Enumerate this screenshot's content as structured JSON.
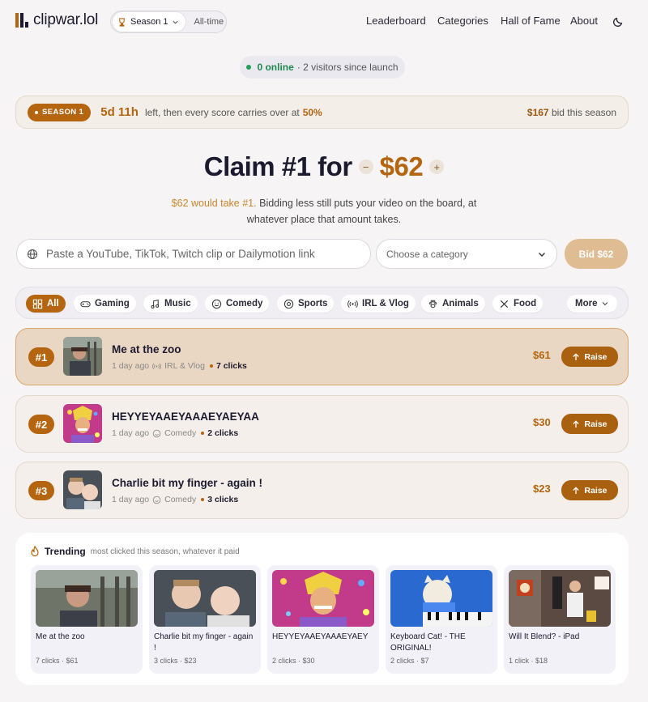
{
  "brand": {
    "name": "clipwar.lol"
  },
  "season_selector": {
    "label": "Season 1",
    "alt": "All-time"
  },
  "nav": [
    "Leaderboard",
    "Categories",
    "Hall of Fame",
    "About"
  ],
  "online": {
    "count": "0 online",
    "rest": "· 2 visitors since launch"
  },
  "season_banner": {
    "badge": "SEASON 1",
    "time_left": "5d 11h",
    "text": "left, then every score carries over at",
    "carry_pct": "50%",
    "bid_amount": "$167",
    "bid_text": "bid this season"
  },
  "claim": {
    "heading": "Claim #1 for",
    "amount": "$62",
    "minus": "−",
    "plus": "+",
    "sub_highlight": "$62 would take #1.",
    "sub_rest": "Bidding less still puts your video on the board, at whatever place that amount takes."
  },
  "form": {
    "url_placeholder": "Paste a YouTube, TikTok, Twitch clip or Dailymotion link",
    "category_placeholder": "Choose a category",
    "bid_label": "Bid $62"
  },
  "filters": {
    "all": "All",
    "gaming": "Gaming",
    "music": "Music",
    "comedy": "Comedy",
    "sports": "Sports",
    "irl": "IRL & Vlog",
    "animals": "Animals",
    "food": "Food",
    "more": "More"
  },
  "leaderboard": [
    {
      "rank": "#1",
      "title": "Me at the zoo",
      "age": "1 day ago",
      "category": "IRL & Vlog",
      "clicks": "7 clicks",
      "amount": "$61",
      "raise": "Raise"
    },
    {
      "rank": "#2",
      "title": "HEYYEYAAEYAAAEYAEYAA",
      "age": "1 day ago",
      "category": "Comedy",
      "clicks": "2 clicks",
      "amount": "$30",
      "raise": "Raise"
    },
    {
      "rank": "#3",
      "title": "Charlie bit my finger - again !",
      "age": "1 day ago",
      "category": "Comedy",
      "clicks": "3 clicks",
      "amount": "$23",
      "raise": "Raise"
    }
  ],
  "trending": {
    "title": "Trending",
    "subtitle": "most clicked this season, whatever it paid",
    "cards": [
      {
        "title": "Me at the zoo",
        "meta": "7 clicks · $61"
      },
      {
        "title": "Charlie bit my finger - again !",
        "meta": "3 clicks · $23"
      },
      {
        "title": "HEYYEYAAEYAAAEYAEY",
        "meta": "2 clicks · $30"
      },
      {
        "title": "Keyboard Cat! - THE ORIGINAL!",
        "meta": "2 clicks · $7"
      },
      {
        "title": "Will It Blend? - iPad",
        "meta": "1 click · $18"
      }
    ]
  },
  "colors": {
    "accent": "#b5650f",
    "online": "#22a05a",
    "background": "#f6f4f4"
  }
}
